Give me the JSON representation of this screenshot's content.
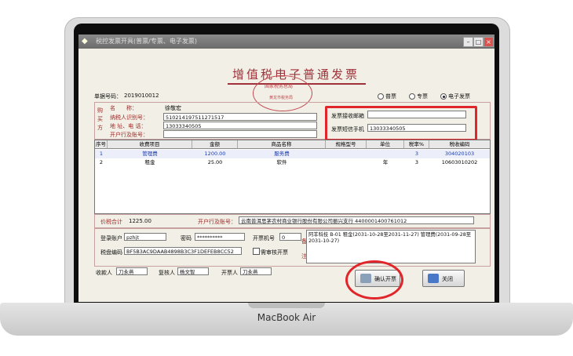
{
  "device": {
    "brand": "MacBook Air"
  },
  "window": {
    "title": "税控发票开具(普票/专票、电子发票)"
  },
  "form": {
    "title": "增值税电子普通发票",
    "seal_line1": "国家税务总局",
    "seal_line2": "黄龙市税务局",
    "doc_no_label": "单据号码：",
    "doc_no": "2019010012"
  },
  "invoice_types": [
    {
      "label": "普票",
      "selected": false
    },
    {
      "label": "专票",
      "selected": false
    },
    {
      "label": "电子发票",
      "selected": true
    }
  ],
  "buyer": {
    "side_label": "购买方",
    "name_label": "名　　称：",
    "name": "徐敬宏",
    "tax_id_label": "纳税人识别号：",
    "tax_id": "510214197511271517",
    "addr_label": "地 址、电 话：",
    "addr": "13033340505",
    "bank_label": "开户行及账号：",
    "bank": ""
  },
  "delivery": {
    "email_label": "发票接收邮箱",
    "email": "",
    "phone_label": "发票短信手机",
    "phone": "13033340505"
  },
  "table": {
    "headers": [
      "序号",
      "收费项目",
      "金额",
      "商品名称",
      "规格型号",
      "单位",
      "税率%",
      "税收编码"
    ],
    "rows": [
      [
        "1",
        "管理费",
        "1200.00",
        "服务费",
        "",
        "",
        "3",
        "304020103"
      ],
      [
        "2",
        "租金",
        "25.00",
        "软件",
        "",
        "年",
        "3",
        "10603010202"
      ]
    ]
  },
  "totals": {
    "total_label": "价税合计",
    "total": "1225.00",
    "seller_bank_label": "开户行及账号：",
    "seller_bank": "云南普洱思茅农村商业银行股份有限公司振兴支行 4400001400761012"
  },
  "login": {
    "account_label": "登录账户",
    "account": "pzhjt",
    "password_label": "密码",
    "password": "**********",
    "machine_label": "开票机号",
    "machine": "0",
    "cert_label": "税盘编码",
    "cert": "BF5B3AC9DAAB4898B3C3F1DEFEB8CC52",
    "review_label": "需审核开票"
  },
  "remark": {
    "label1": "备",
    "label2": "注",
    "text": "阿羊科技 B-01 租金(2031-10-28至2031-11-27) 管理费(2031-09-28至2031-10-27)"
  },
  "footer": {
    "payee_label": "收款人",
    "payee": "刀永燕",
    "reviewer_label": "复核人",
    "reviewer": "杨文智",
    "drawer_label": "开票人",
    "drawer": "刀永燕"
  },
  "buttons": {
    "confirm": "确认开票",
    "close": "关闭"
  },
  "colors": {
    "highlight": "#e0262b",
    "seal": "#c24a52",
    "title": "#a0303a"
  }
}
